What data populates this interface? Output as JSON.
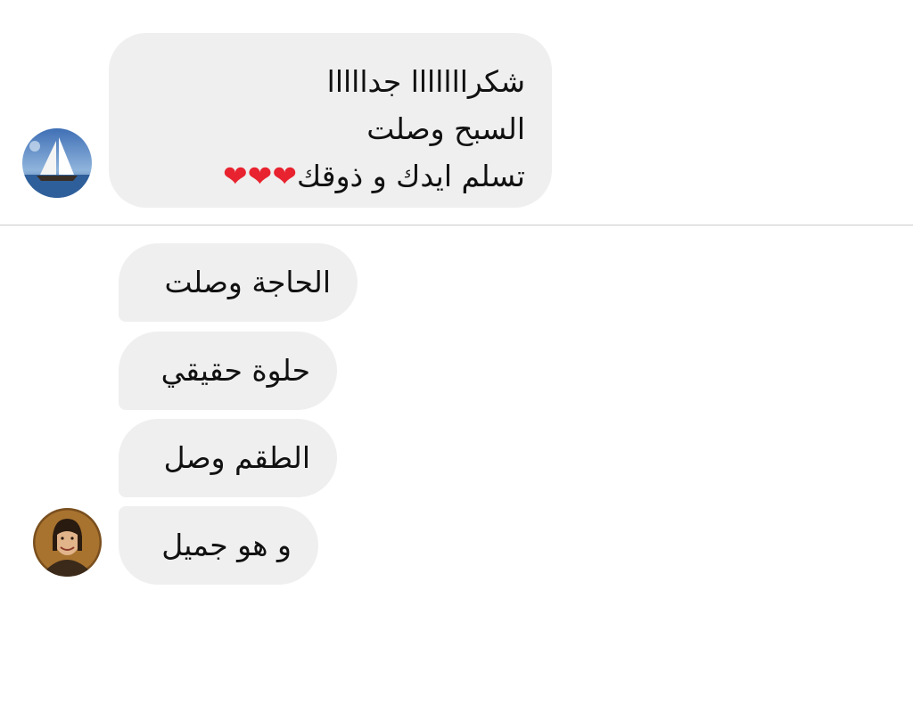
{
  "messages_group_1": {
    "lines": [
      "شكرااااااا جدااااا",
      "السبح وصلت",
      "تسلم ايدك و ذوقك"
    ],
    "hearts": "❤❤❤",
    "avatar_icon": "sailboat-avatar-icon"
  },
  "messages_group_2": {
    "bubbles": [
      "الحاجة وصلت",
      "حلوة حقيقي",
      "الطقم وصل",
      "و هو جميل"
    ],
    "avatar_icon": "woman-portrait-avatar-icon"
  },
  "colors": {
    "bubble_bg": "#efefef",
    "heart": "#e8232f",
    "divider": "#c9c9c9"
  }
}
